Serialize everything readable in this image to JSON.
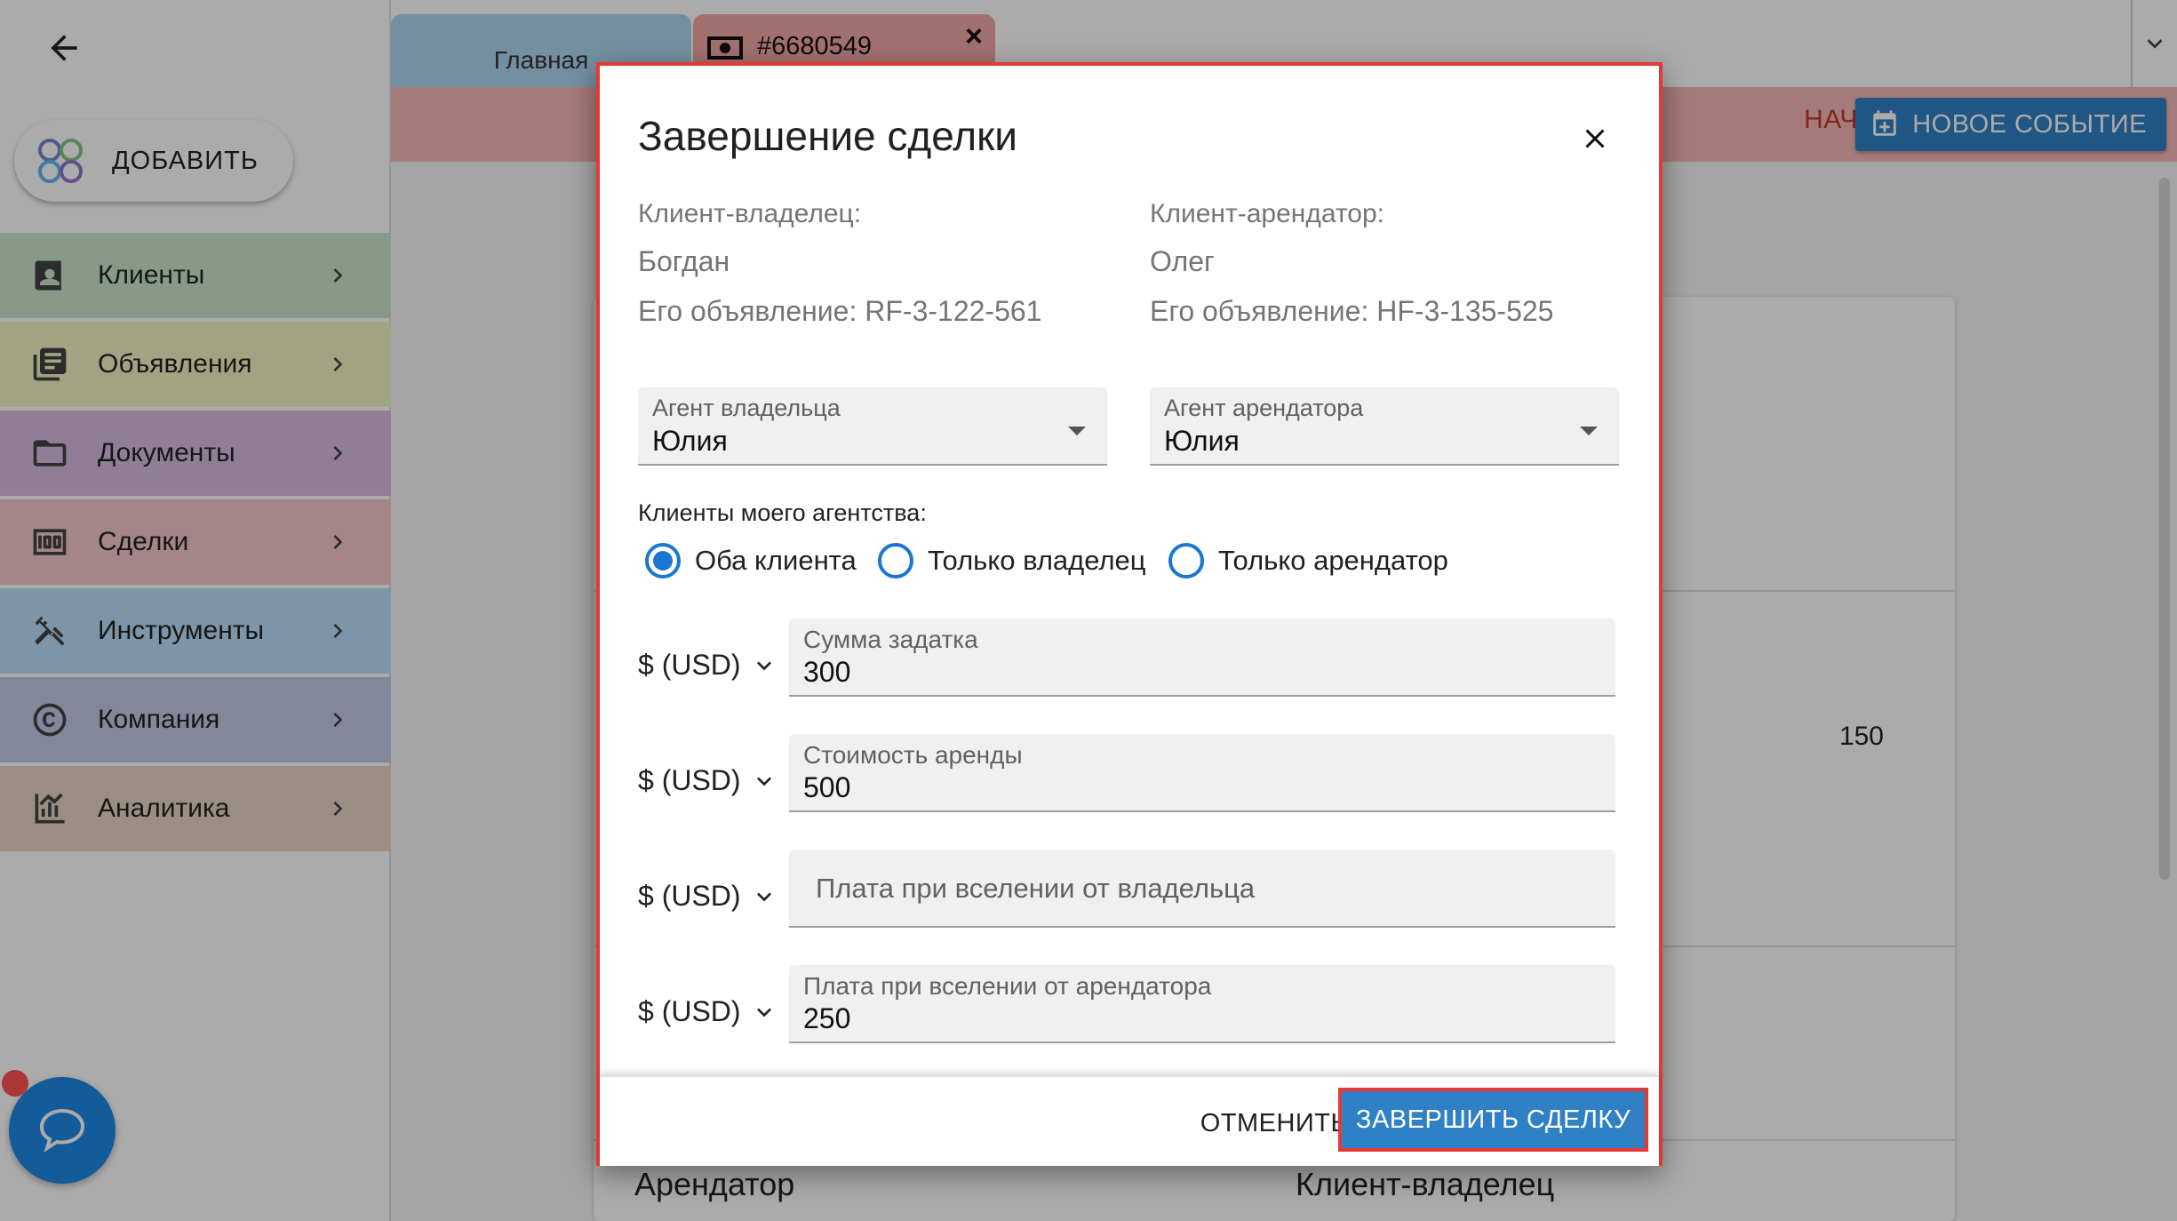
{
  "sidebar": {
    "add_label": "ДОБАВИТЬ",
    "items": [
      {
        "label": "Клиенты",
        "icon": "contacts-icon",
        "color": "#c8e6c9"
      },
      {
        "label": "Объявления",
        "icon": "listings-icon",
        "color": "#f0f4c3"
      },
      {
        "label": "Документы",
        "icon": "folder-icon",
        "color": "#d7bde2"
      },
      {
        "label": "Сделки",
        "icon": "money-icon",
        "color": "#f5c6cb"
      },
      {
        "label": "Инструменты",
        "icon": "tools-icon",
        "color": "#bbdefb"
      },
      {
        "label": "Компания",
        "icon": "copyright-icon",
        "color": "#c5cae9"
      },
      {
        "label": "Аналитика",
        "icon": "analytics-icon",
        "color": "#e8d5c4"
      }
    ]
  },
  "tabs": {
    "home_label": "Главная",
    "deal_label": "#6680549"
  },
  "header": {
    "task_label": "НАЧИТЬ ЗАДАЧУ",
    "event_label": "НОВОЕ СОБЫТИЕ"
  },
  "background": {
    "value": "150",
    "footer_left": "Арендатор",
    "footer_right": "Клиент-владелец"
  },
  "dialog": {
    "title": "Завершение сделки",
    "owner_client_label": "Клиент-владелец:",
    "owner_client_name": "Богдан",
    "owner_listing": "Его объявление: RF-3-122-561",
    "tenant_client_label": "Клиент-арендатор:",
    "tenant_client_name": "Олег",
    "tenant_listing": "Его объявление: HF-3-135-525",
    "owner_agent_label": "Агент владельца",
    "owner_agent_value": "Юлия",
    "tenant_agent_label": "Агент арендатора",
    "tenant_agent_value": "Юлия",
    "agency_clients_label": "Клиенты моего агентства:",
    "radio_both": "Оба клиента",
    "radio_owner": "Только владелец",
    "radio_tenant": "Только арендатор",
    "currency": "$ (USD)",
    "deposit_label": "Сумма задатка",
    "deposit_value": "300",
    "rent_label": "Стоимость аренды",
    "rent_value": "500",
    "owner_fee_placeholder": "Плата при вселении от владельца",
    "tenant_fee_label": "Плата при вселении от арендатора",
    "tenant_fee_value": "250",
    "cancel_label": "ОТМЕНИТЬ",
    "finish_label": "ЗАВЕРШИТЬ СДЕЛКУ"
  }
}
